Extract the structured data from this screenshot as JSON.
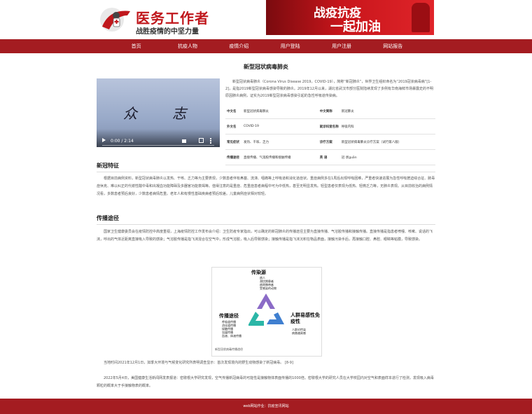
{
  "header": {
    "logo_title": "医务工作者",
    "logo_subtitle": "战胜疫情的中坚力量",
    "banner_line1": "战疫抗疫",
    "banner_line2": "一起加油"
  },
  "nav": [
    "首页",
    "抗疫人物",
    "疫情介绍",
    "用户登陆",
    "用户注册",
    "网站报告"
  ],
  "article": {
    "title": "新型冠状病毒肺炎",
    "video": {
      "char1": "众",
      "char2": "志",
      "time": "0:00 / 2:14"
    },
    "intro": "新型冠状病毒肺炎（Corona Virus Disease 2019，COVID-19），简称“新冠肺炎”，世界卫生组织命名为“2019冠状病毒病”[1-2]，是指2019新型冠状病毒感染导致的肺炎。2019年12月以来，湖北省武汉市部分医院陆续发现了多例有华南海鲜市场暴露史的不明原因肺炎病例，证实为2019新型冠状病毒感染引起的急性呼吸道传染病。",
    "info_rows": [
      [
        "中文名",
        "新型冠状病毒肺炎",
        "中文简称",
        "新冠肺炎"
      ],
      [
        "外文名",
        "COVID-19",
        "就诊科室名称",
        "呼吸内科"
      ],
      [
        "常见症状",
        "发热、干咳、乏力",
        "诊疗方案",
        "新型冠状病毒肺炎诊疗方案（试行第八版）"
      ],
      [
        "传播途径",
        "直接传播、气溶胶传播和接触传播",
        "英 语",
        "冠 状guān"
      ]
    ]
  },
  "section1": {
    "heading": "新冠特征",
    "text": "根据目前病例资料，新型冠状病毒肺炎以发热、干咳、乏力等为主要表现，少数患者伴有鼻塞、流涕、咽痛等上呼吸道和消化道症状。重症病例多在1周后出现呼吸困难，严重者快速进展为急性呼吸窘迫综合征、脓毒症休克、难以纠正的代谢性酸中毒和出凝血功能障碍及多器官功能衰竭等。值得注意的是重症、危重症患者病程中可为中低热，甚至无明显发热。轻型患者仅表现为低热、轻微乏力等，无肺炎表现。从目前收治的病例情况看，多数患者预后良好，少数患者病情危重。老年人和有慢性基础疾病者预后较差。儿童病例症状相对较轻。"
  },
  "section2": {
    "heading": "传播途径",
    "text": "国家卫生健康委员会在疫情防控中高度重视，上海疫情防控工作发布会介绍：卫生防疫专家指出，可以确定的新冠肺炎的传播途径主要为直接传播、气溶胶传播和接触传播。直接传播是指患者喷嚏、咳嗽、说话的飞沫，呼出的气体近距离直接吸入导致的感染；气溶胶传播是指飞沫混合在空气中，形成气溶胶，吸入后导致感染；接触传播是指飞沫沉积在物品表面，接触污染手后，再接触口腔、鼻腔、眼睛等粘膜，导致感染。"
  },
  "figure": {
    "label_source": "传染源",
    "source_items": [
      "病人",
      "潜伏期患者",
      "病原携带者",
      "受感染的动物"
    ],
    "label_route": "传播途径",
    "route_items": [
      "呼吸道传播",
      "消化道传播",
      "接触传播",
      "虫媒传播",
      "血液、体液传播"
    ],
    "label_host": "人群易感性免疫性",
    "host_items": [
      "人群对传染",
      "病普遍易感"
    ],
    "caption": "新型冠状病毒传播途径",
    "colors": {
      "purple": "#8b6bc7",
      "teal": "#2bb6a7",
      "blue": "#3f7fd0"
    }
  },
  "para3": "当地时间2021年12月1日，如季大环境与气候变化研究所表明调查显示：首次发现境内的野生动物感染了新冠病毒。 [8-9]",
  "para4": "2022年5月4日，美国健康生活新闻网发表报道：密歇根大学研究发现，空气传播新冠病毒的可能性是接触物体表面传播的1000倍。密歇根大学的研究人员在大学校园内对空气和表面样本进行了检测，发现吸入病毒颗粒的概率大于手接触物表的概率。",
  "footer": "web网站作业：抗疫宣讯网站",
  "colors": {
    "brand_red": "#a41c21",
    "banner_red": "#c8151b"
  }
}
